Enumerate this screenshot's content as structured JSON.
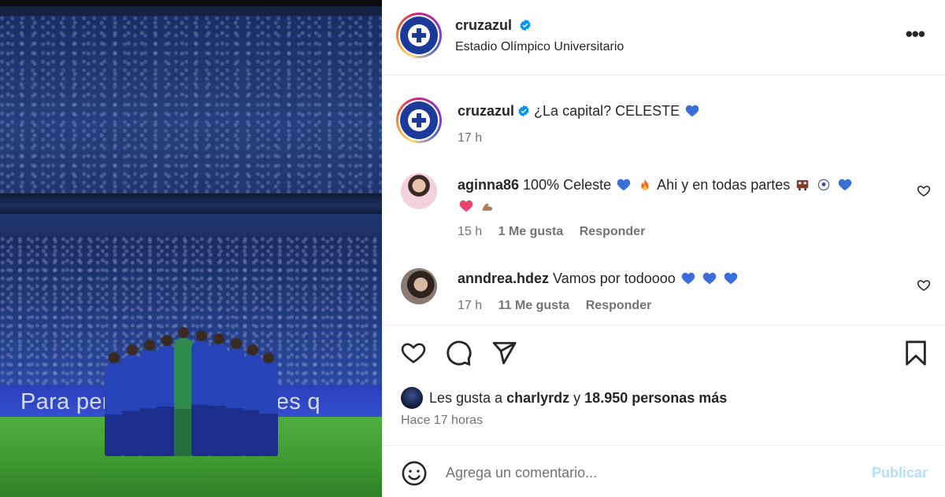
{
  "post": {
    "banner_text": "Para pertenecer hoy tienes q",
    "account": {
      "username": "cruzazul",
      "verified": true,
      "location": "Estadio Olímpico Universitario"
    },
    "caption": {
      "username": "cruzazul",
      "text": "¿La capital? CELESTE",
      "time": "17 h"
    },
    "comments": [
      {
        "username": "aginna86",
        "text_before": "100% Celeste",
        "text_after": "Ahi y en todas partes",
        "time": "15 h",
        "likes": "1 Me gusta",
        "reply": "Responder"
      },
      {
        "username": "anndrea.hdez",
        "text": "Vamos por todoooo",
        "time": "17 h",
        "likes": "11 Me gusta",
        "reply": "Responder"
      }
    ],
    "likes_line": {
      "prefix": "Les gusta a",
      "user": "charlyrdz",
      "connector": "y",
      "others": "18.950 personas más"
    },
    "posted_ago": "Hace 17 horas",
    "add_comment": {
      "placeholder": "Agrega un comentario...",
      "publish": "Publicar"
    },
    "colors": {
      "accent_blue": "#0095f6",
      "publish_disabled": "#b2dffc",
      "secondary_text": "#737373",
      "verified_badge": "#0095f6"
    },
    "icons": [
      "more-options-icon",
      "verified-icon",
      "heart-icon",
      "comment-icon",
      "share-icon",
      "bookmark-icon",
      "emoji-icon"
    ]
  }
}
